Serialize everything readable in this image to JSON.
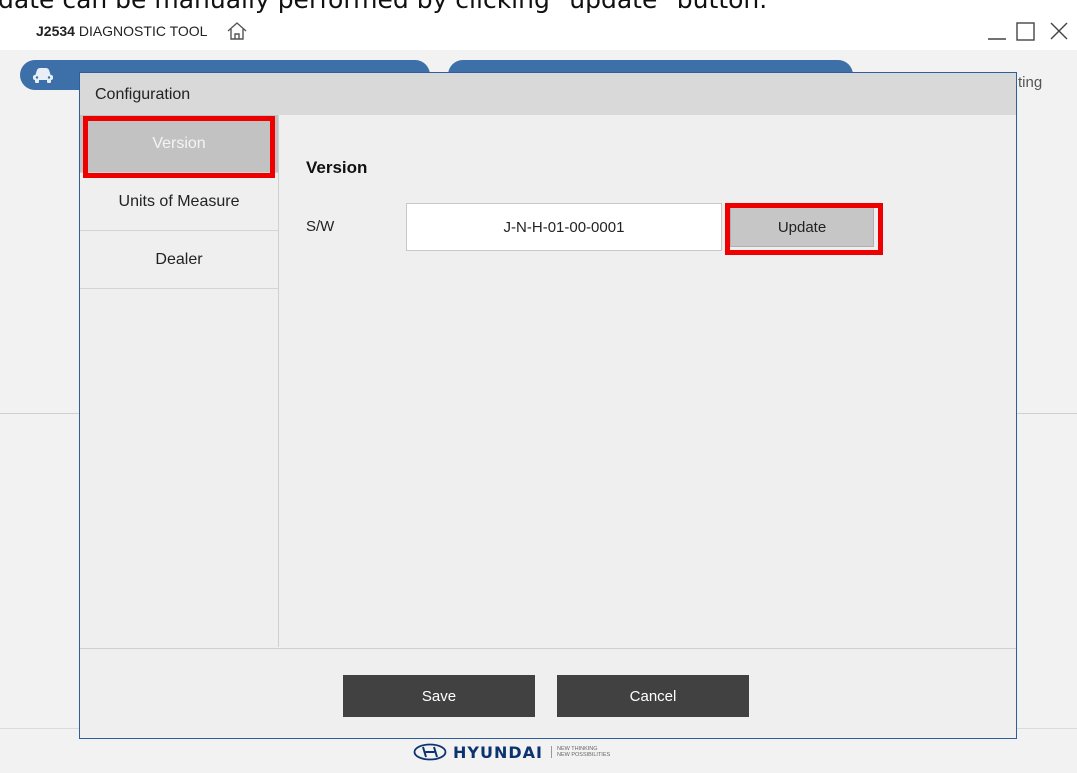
{
  "caption": "date can be manually performed by clicking \"update\" button.",
  "window": {
    "title_bold": "J2534",
    "title_rest": " DIAGNOSTIC TOOL",
    "background_tab_tail": "ting"
  },
  "dialog": {
    "title": "Configuration",
    "sidebar": {
      "items": [
        {
          "label": "Version",
          "active": true
        },
        {
          "label": "Units of Measure",
          "active": false
        },
        {
          "label": "Dealer",
          "active": false
        }
      ]
    },
    "content": {
      "section_title": "Version",
      "sw_label": "S/W",
      "sw_value": "J-N-H-01-00-0001",
      "update_label": "Update"
    },
    "footer": {
      "save_label": "Save",
      "cancel_label": "Cancel"
    }
  },
  "brand": {
    "name": "HYUNDAI",
    "tagline_1": "NEW THINKING",
    "tagline_2": "NEW POSSIBILITIES"
  },
  "colors": {
    "highlight": "#ee0000",
    "tab_blue": "#3d6fa8",
    "dialog_border": "#2f5e9a",
    "button_dark": "#414141"
  },
  "icons": [
    "home-icon",
    "car-icon",
    "minimize-icon",
    "maximize-icon",
    "close-icon",
    "hyundai-logo-icon"
  ]
}
